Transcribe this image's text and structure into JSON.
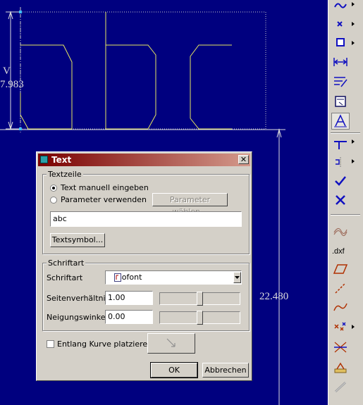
{
  "canvas": {
    "dimension_top_label": "V",
    "dimension_top_value": "7.983",
    "dimension_right_value": "22.480",
    "sketch_text": "abc"
  },
  "toolbar": {
    "tools": [
      {
        "icon": "spline-icon"
      },
      {
        "icon": "point-icon"
      },
      {
        "icon": "rectangle-icon"
      },
      {
        "icon": "dimension-icon"
      },
      {
        "icon": "modify-icon"
      },
      {
        "icon": "table-icon"
      },
      {
        "icon": "text-icon",
        "active": true
      },
      {
        "icon": "split-icon"
      },
      {
        "icon": "mirror-icon"
      },
      {
        "icon": "accept-checkmark-icon"
      },
      {
        "icon": "cancel-x-icon"
      },
      {
        "icon": "offset-curve-icon"
      },
      {
        "icon": "dxf-import-icon"
      },
      {
        "icon": "parallelogram-icon"
      },
      {
        "icon": "construction-line-icon"
      },
      {
        "icon": "curve-icon"
      },
      {
        "icon": "delete-segment-icon"
      },
      {
        "icon": "intersect-icon"
      },
      {
        "icon": "palette-icon"
      },
      {
        "icon": "chain-icon"
      }
    ],
    "accent_colors": {
      "checkmark": "#1010c0",
      "red_tools": "#b03000"
    }
  },
  "dialog": {
    "title": "Text",
    "close_symbol": "✕",
    "textzeile": {
      "legend": "Textzeile",
      "option_manual": "Text manuell eingeben",
      "option_manual_selected": true,
      "option_param": "Parameter verwenden",
      "option_param_selected": false,
      "param_button": "Parameter wählen...",
      "text_value": "abc",
      "symbol_button": "Textsymbol..."
    },
    "schriftart": {
      "legend": "Schriftart",
      "font_label": "Schriftart",
      "font_value": "isofont",
      "aspect_label": "Seitenverhältnis",
      "aspect_value": "1.00",
      "aspect_slider": 0.5,
      "slant_label": "Neigungswinkel",
      "slant_value": "0.00",
      "slant_slider": 0.5
    },
    "along_curve_label": "Entlang Kurve platzieren",
    "along_curve_checked": false,
    "ok_button": "OK",
    "cancel_button": "Abbrechen"
  }
}
